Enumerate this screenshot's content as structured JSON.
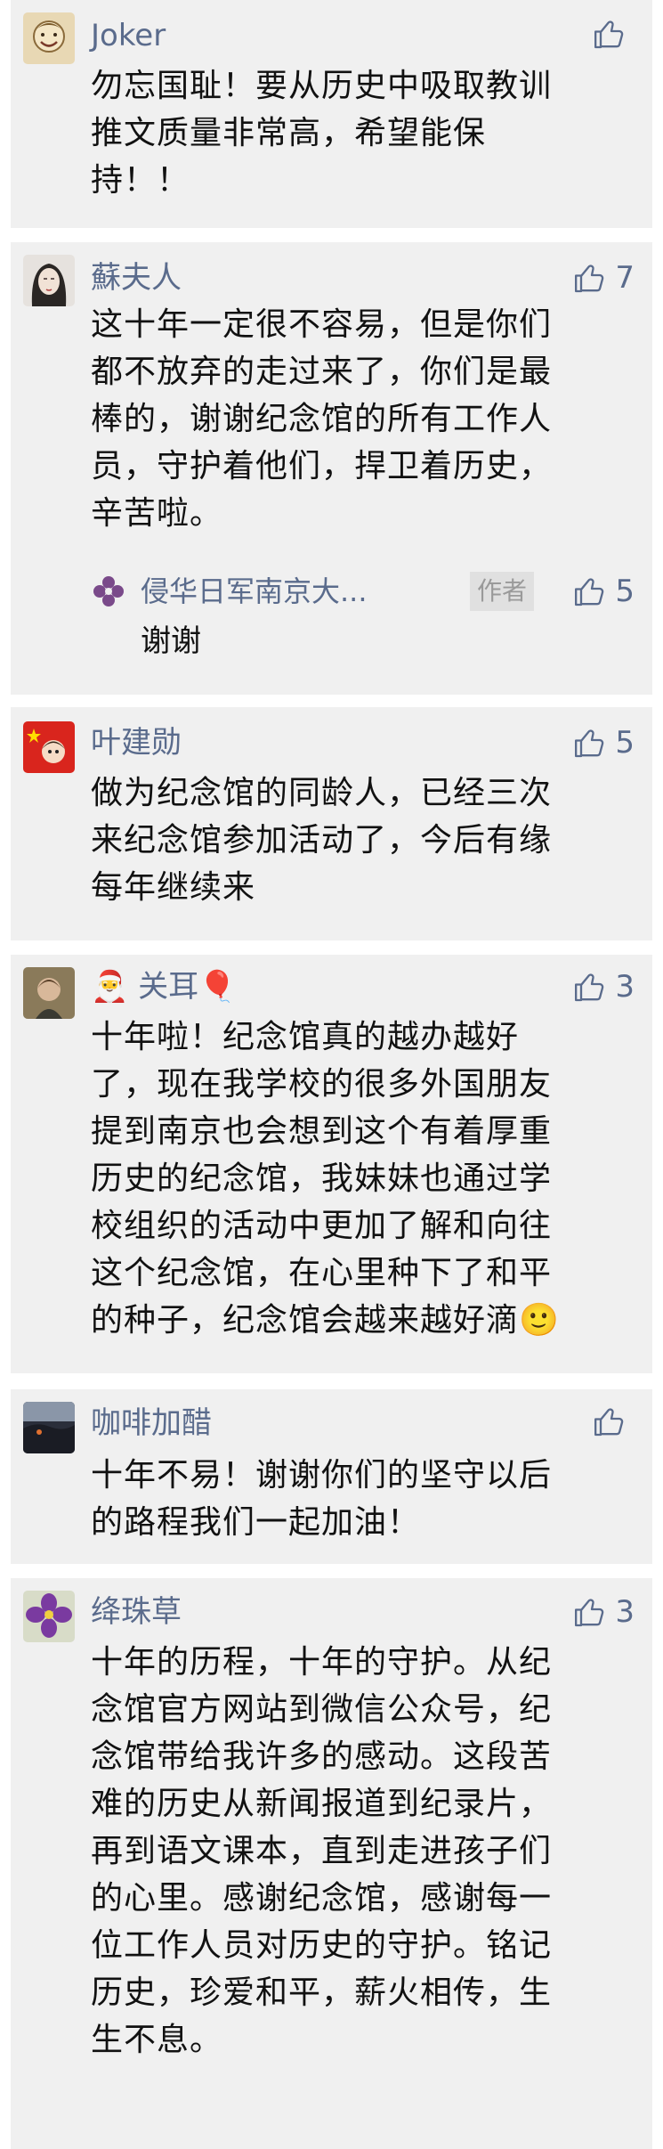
{
  "comments": [
    {
      "name": "Joker",
      "likes": "",
      "text": "勿忘国耻！要从历史中吸取教训\n推文质量非常高，希望能保\n持！！"
    },
    {
      "name": "蘇夫人",
      "likes": "7",
      "text": "这十年一定很不容易，但是你们\n都不放弃的走过来了，你们是最\n棒的，谢谢纪念馆的所有工作人\n员，守护着他们，捍卫着历史，\n辛苦啦。",
      "reply": {
        "name": "侵华日军南京大...",
        "tag": "作者",
        "likes": "5",
        "text": "谢谢"
      }
    },
    {
      "name": "叶建勋",
      "likes": "5",
      "text": "做为纪念馆的同龄人，已经三次\n来纪念馆参加活动了，今后有缘\n每年继续来"
    },
    {
      "name": "🎅 关耳🎈",
      "likes": "3",
      "text": "十年啦！纪念馆真的越办越好\n了，现在我学校的很多外国朋友\n提到南京也会想到这个有着厚重\n历史的纪念馆，我妹妹也通过学\n校组织的活动中更加了解和向往\n这个纪念馆，在心里种下了和平\n的种子，纪念馆会越来越好滴🙂"
    },
    {
      "name": "咖啡加醋",
      "likes": "",
      "text": "十年不易！谢谢你们的坚守以后\n的路程我们一起加油！"
    },
    {
      "name": "绛珠草",
      "likes": "3",
      "text": "十年的历程，十年的守护。从纪\n念馆官方网站到微信公众号，纪\n念馆带给我许多的感动。这段苦\n难的历史从新闻报道到纪录片，\n再到语文课本，直到走进孩子们\n的心里。感谢纪念馆，感谢每一\n位工作人员对历史的守护。铭记\n历史，珍爱和平，薪火相传，生\n生不息。"
    }
  ],
  "colors": {
    "card_bg": "#f0f0f0",
    "name": "#5a6b8c",
    "text": "#111111"
  }
}
